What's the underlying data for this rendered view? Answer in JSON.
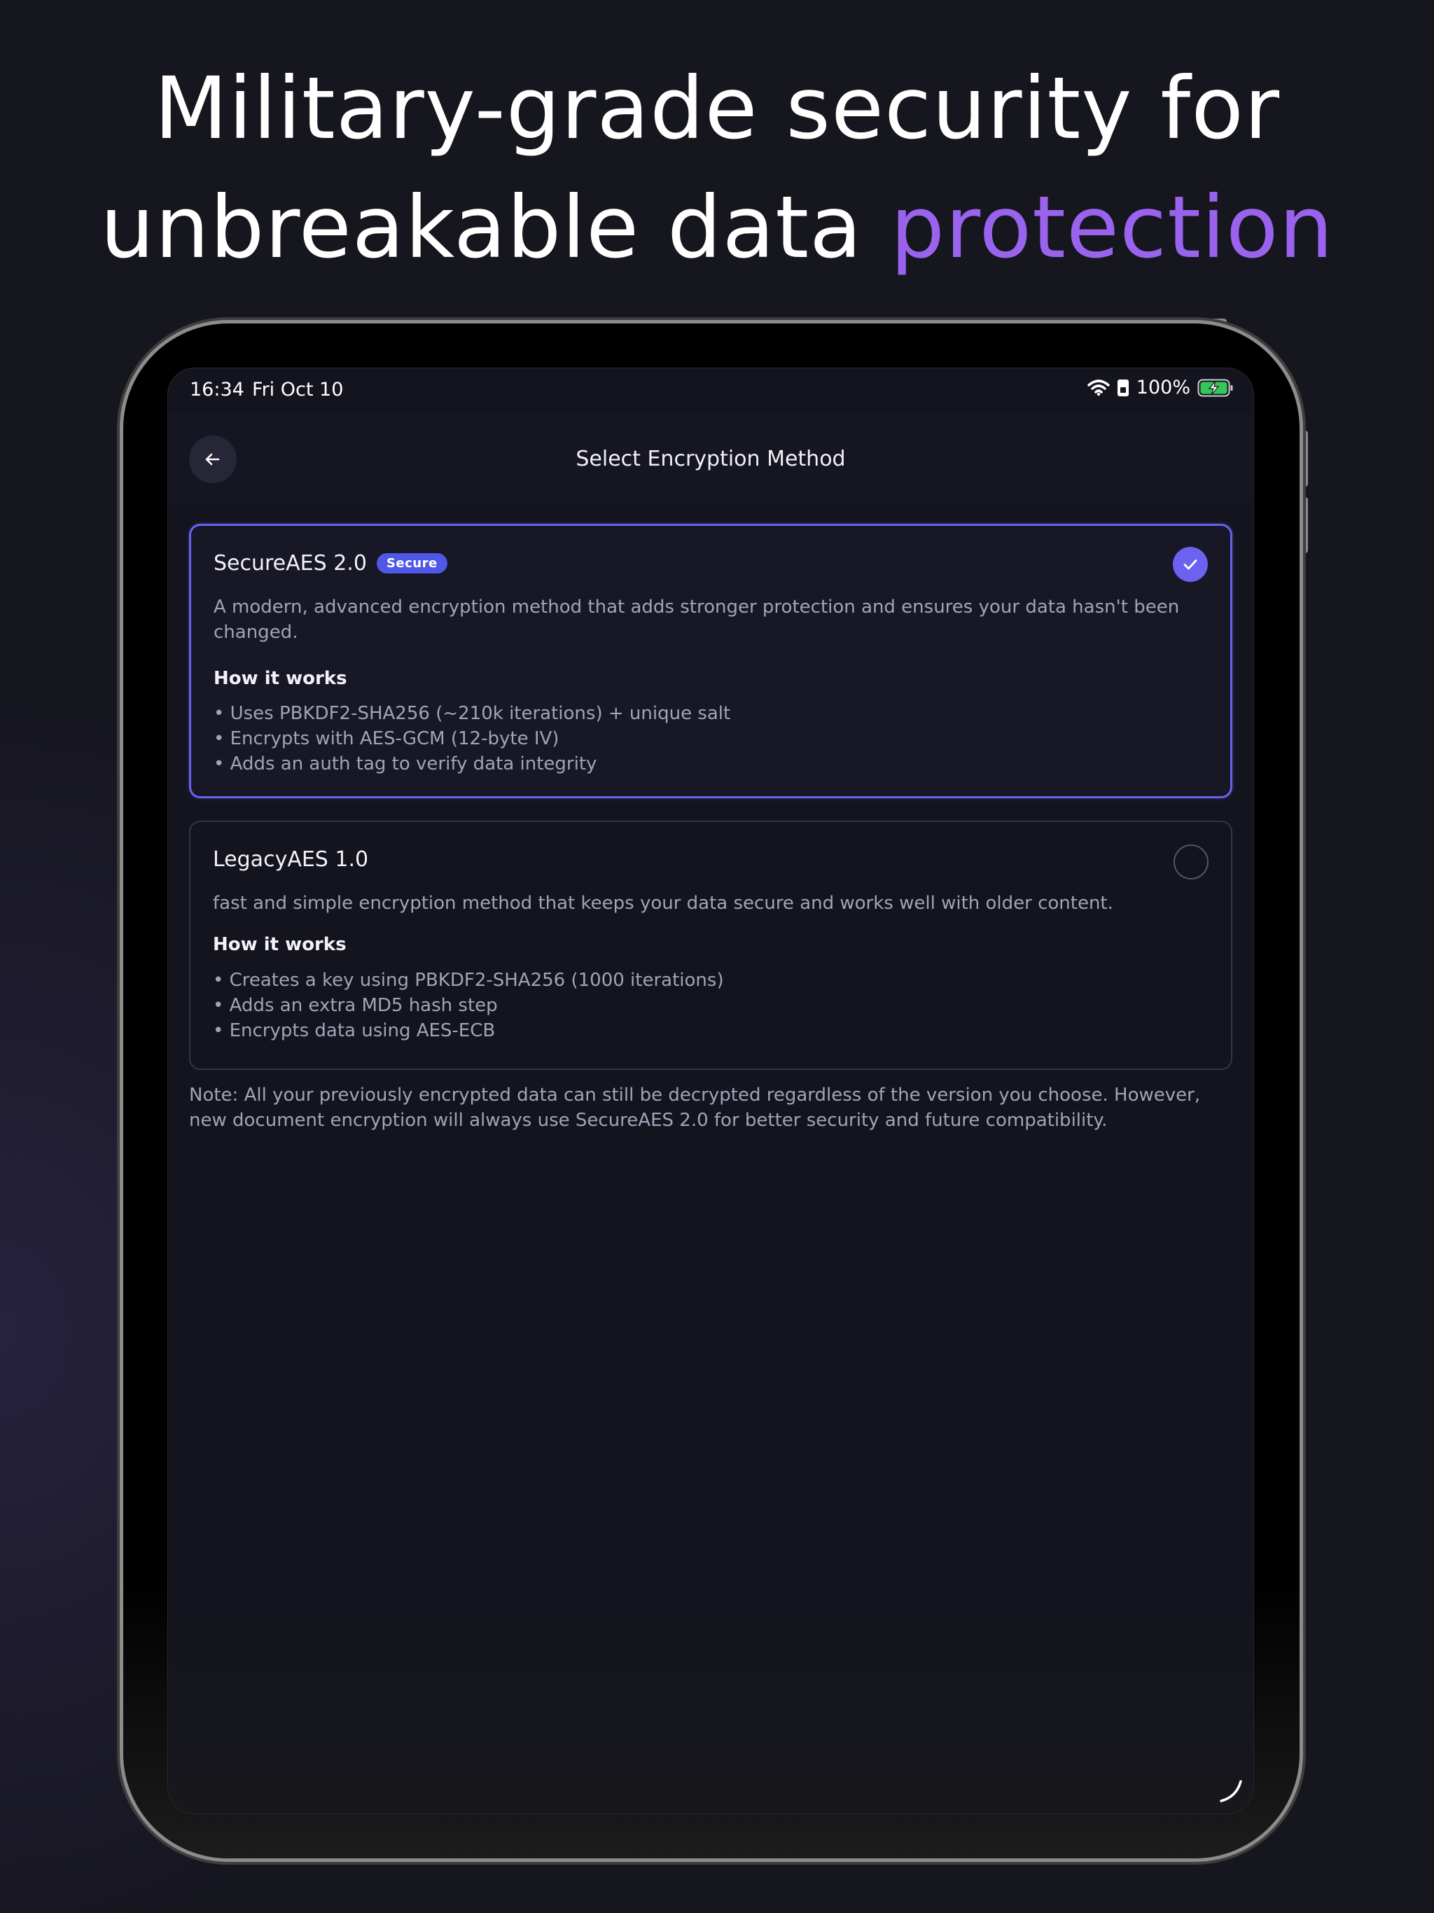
{
  "headline": {
    "line1": "Military-grade security for",
    "line2_main": "unbreakable data ",
    "line2_accent": "protection"
  },
  "status_bar": {
    "time": "16:34",
    "date": "Fri Oct 10",
    "battery": "100%",
    "icons": [
      "wifi-icon",
      "sim-icon",
      "battery-charging-icon"
    ]
  },
  "nav": {
    "title": "Select Encryption Method",
    "back_icon": "arrow-left-icon"
  },
  "options": [
    {
      "title": "SecureAES 2.0",
      "badge": "Secure",
      "selected": true,
      "description": "A modern, advanced encryption method that adds stronger protection and ensures your data hasn't been changed.",
      "section_title": "How it works",
      "bullets": [
        "Uses PBKDF2-SHA256 (~210k iterations) + unique salt",
        "Encrypts with AES-GCM (12-byte IV)",
        "Adds an auth tag to verify data integrity"
      ]
    },
    {
      "title": "LegacyAES 1.0",
      "selected": false,
      "description": "fast and simple encryption method that keeps your data secure and works well with older content.",
      "section_title": "How it works",
      "bullets": [
        "Creates a key using PBKDF2-SHA256 (1000 iterations)",
        "Adds an extra MD5 hash step",
        "Encrypts data using AES-ECB"
      ]
    }
  ],
  "note": "Note: All your previously encrypted data can still be decrypted regardless of the version you choose. However, new document encryption will always use SecureAES 2.0 for better security and future compatibility.",
  "colors": {
    "accent": "#9a63ee",
    "selected_border": "#6962ee",
    "badge": "#5058e8",
    "background": "#14141f"
  }
}
